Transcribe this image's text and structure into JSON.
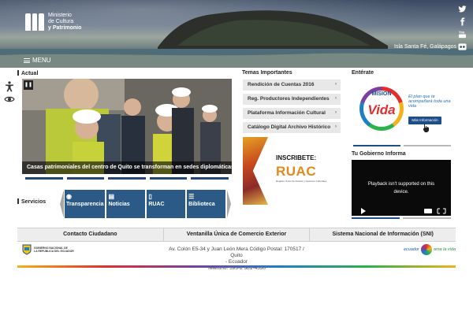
{
  "header": {
    "logo_line1": "Ministerio",
    "logo_line2": "de Cultura",
    "logo_line3": "y Patrimonio",
    "location": "Isla Santa Fé, Galápagos",
    "menu_label": "MENU",
    "social_icons": [
      "twitter-icon",
      "facebook-icon",
      "youtube-icon",
      "flickr-icon"
    ]
  },
  "actual": {
    "heading": "Actual",
    "caption": "Casas patrimoniales del centro de Quito se transforman en sedes diplomáticas",
    "slide_count": 5
  },
  "servicios": {
    "heading": "Servicios",
    "items": [
      {
        "label": "Transparencia",
        "icon": "eye-icon"
      },
      {
        "label": "Noticias",
        "icon": "notes-icon"
      },
      {
        "label": "RUAC",
        "icon": "doc-icon"
      },
      {
        "label": "Biblioteca",
        "icon": "list-icon"
      }
    ]
  },
  "temas": {
    "heading": "Temas Importantes",
    "items": [
      "Rendición de Cuentas 2016",
      "Reg. Productores Independientes",
      "Plataforma Información Cultural",
      "Catálogo Digital Archivo Histórico"
    ],
    "banner_inscribete": "INSCRIBETE:",
    "banner_ruac": "RUAC",
    "banner_sub": "Registro Único de Artistas y Gestores Culturales"
  },
  "enterate": {
    "heading": "Entérate",
    "mision_word": "MISIÓN",
    "vida_word": "Vida",
    "tagline": "El plan que te acompañará toda una vida",
    "button_label": "Más Información"
  },
  "gobierno": {
    "heading": "Tu Gobierno Informa",
    "video_message_line1": "Playback isn't supported on this",
    "video_message_line2": "device."
  },
  "footer": {
    "links": [
      "Contacto Ciudadano",
      "Ventanilla Única de Comercio Exterior",
      "Sistema Nacional de Información (SNI)"
    ],
    "gob_line1": "GOBIERNO NACIONAL DE",
    "gob_line2": "LA REPÚBLICA DEL ECUADOR",
    "address_line1": "Av. Colón E5-34 y Juan León Mera Código Postal: 170517 / Quito",
    "address_line2": "- Ecuador",
    "address_line3": "Teléfono: 593-2 381-4550",
    "ecu_word": "ecuador",
    "ecu_ama": "ama la vida"
  }
}
